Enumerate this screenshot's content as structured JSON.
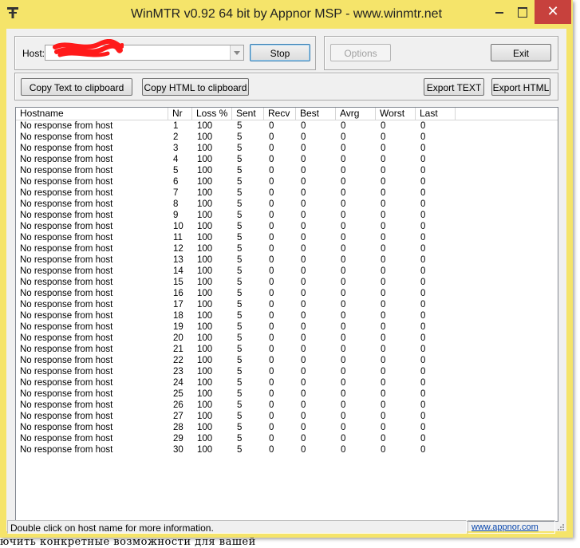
{
  "background_text": "ючить конкретные возможности для вашей",
  "window": {
    "title": "WinMTR v0.92 64 bit by Appnor MSP - www.winmtr.net",
    "close_symbol": "✕"
  },
  "host": {
    "label": "Host:",
    "value": ""
  },
  "buttons": {
    "stop": "Stop",
    "options": "Options",
    "exit": "Exit",
    "copy_text": "Copy Text to clipboard",
    "copy_html": "Copy HTML to clipboard",
    "export_text": "Export TEXT",
    "export_html": "Export HTML"
  },
  "table": {
    "columns": [
      "Hostname",
      "Nr",
      "Loss %",
      "Sent",
      "Recv",
      "Best",
      "Avrg",
      "Worst",
      "Last"
    ],
    "rows": [
      [
        "No response from host",
        "1",
        "100",
        "5",
        "0",
        "0",
        "0",
        "0",
        "0"
      ],
      [
        "No response from host",
        "2",
        "100",
        "5",
        "0",
        "0",
        "0",
        "0",
        "0"
      ],
      [
        "No response from host",
        "3",
        "100",
        "5",
        "0",
        "0",
        "0",
        "0",
        "0"
      ],
      [
        "No response from host",
        "4",
        "100",
        "5",
        "0",
        "0",
        "0",
        "0",
        "0"
      ],
      [
        "No response from host",
        "5",
        "100",
        "5",
        "0",
        "0",
        "0",
        "0",
        "0"
      ],
      [
        "No response from host",
        "6",
        "100",
        "5",
        "0",
        "0",
        "0",
        "0",
        "0"
      ],
      [
        "No response from host",
        "7",
        "100",
        "5",
        "0",
        "0",
        "0",
        "0",
        "0"
      ],
      [
        "No response from host",
        "8",
        "100",
        "5",
        "0",
        "0",
        "0",
        "0",
        "0"
      ],
      [
        "No response from host",
        "9",
        "100",
        "5",
        "0",
        "0",
        "0",
        "0",
        "0"
      ],
      [
        "No response from host",
        "10",
        "100",
        "5",
        "0",
        "0",
        "0",
        "0",
        "0"
      ],
      [
        "No response from host",
        "11",
        "100",
        "5",
        "0",
        "0",
        "0",
        "0",
        "0"
      ],
      [
        "No response from host",
        "12",
        "100",
        "5",
        "0",
        "0",
        "0",
        "0",
        "0"
      ],
      [
        "No response from host",
        "13",
        "100",
        "5",
        "0",
        "0",
        "0",
        "0",
        "0"
      ],
      [
        "No response from host",
        "14",
        "100",
        "5",
        "0",
        "0",
        "0",
        "0",
        "0"
      ],
      [
        "No response from host",
        "15",
        "100",
        "5",
        "0",
        "0",
        "0",
        "0",
        "0"
      ],
      [
        "No response from host",
        "16",
        "100",
        "5",
        "0",
        "0",
        "0",
        "0",
        "0"
      ],
      [
        "No response from host",
        "17",
        "100",
        "5",
        "0",
        "0",
        "0",
        "0",
        "0"
      ],
      [
        "No response from host",
        "18",
        "100",
        "5",
        "0",
        "0",
        "0",
        "0",
        "0"
      ],
      [
        "No response from host",
        "19",
        "100",
        "5",
        "0",
        "0",
        "0",
        "0",
        "0"
      ],
      [
        "No response from host",
        "20",
        "100",
        "5",
        "0",
        "0",
        "0",
        "0",
        "0"
      ],
      [
        "No response from host",
        "21",
        "100",
        "5",
        "0",
        "0",
        "0",
        "0",
        "0"
      ],
      [
        "No response from host",
        "22",
        "100",
        "5",
        "0",
        "0",
        "0",
        "0",
        "0"
      ],
      [
        "No response from host",
        "23",
        "100",
        "5",
        "0",
        "0",
        "0",
        "0",
        "0"
      ],
      [
        "No response from host",
        "24",
        "100",
        "5",
        "0",
        "0",
        "0",
        "0",
        "0"
      ],
      [
        "No response from host",
        "25",
        "100",
        "5",
        "0",
        "0",
        "0",
        "0",
        "0"
      ],
      [
        "No response from host",
        "26",
        "100",
        "5",
        "0",
        "0",
        "0",
        "0",
        "0"
      ],
      [
        "No response from host",
        "27",
        "100",
        "5",
        "0",
        "0",
        "0",
        "0",
        "0"
      ],
      [
        "No response from host",
        "28",
        "100",
        "5",
        "0",
        "0",
        "0",
        "0",
        "0"
      ],
      [
        "No response from host",
        "29",
        "100",
        "5",
        "0",
        "0",
        "0",
        "0",
        "0"
      ],
      [
        "No response from host",
        "30",
        "100",
        "5",
        "0",
        "0",
        "0",
        "0",
        "0"
      ]
    ]
  },
  "status": {
    "message": "Double click on host name for more information.",
    "link": "www.appnor.com"
  },
  "colors": {
    "window_frame": "#f5e46a",
    "close_button": "#c7413d",
    "redaction": "#ff1a1a"
  }
}
